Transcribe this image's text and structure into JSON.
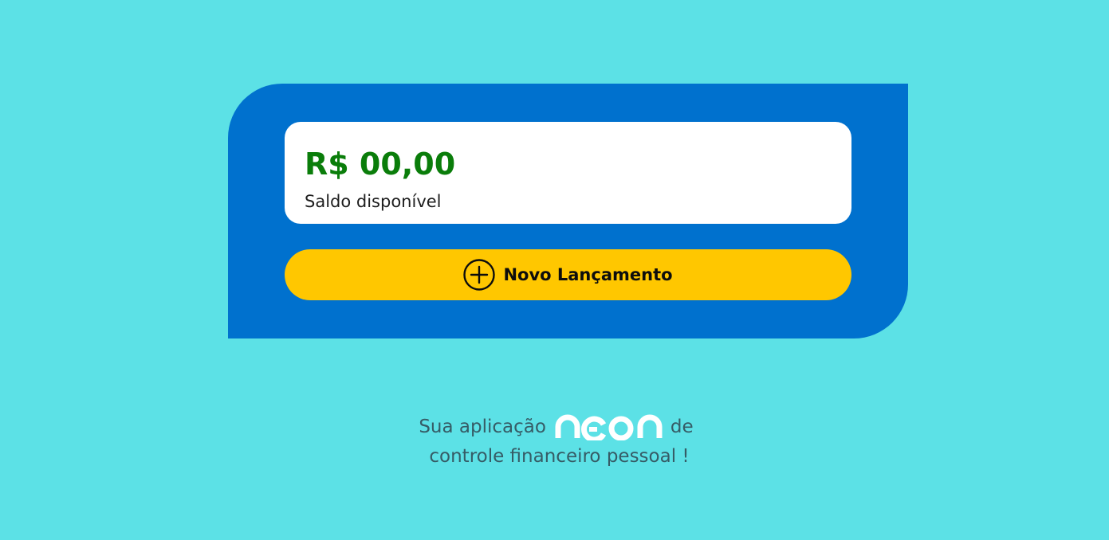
{
  "balance": {
    "amount": "R$ 00,00",
    "label": "Saldo disponível"
  },
  "actions": {
    "new_entry_label": "Novo Lançamento",
    "new_entry_icon": "plus-circle-icon"
  },
  "tagline": {
    "before_logo": "Sua aplicação",
    "logo_text": "neon",
    "after_logo": "de",
    "line2": "controle financeiro pessoal !"
  },
  "colors": {
    "background": "#5ce1e6",
    "panel": "#0071ce",
    "card": "#ffffff",
    "amount": "#0a7d0a",
    "button": "#ffc700",
    "tagline": "#365c66",
    "logo": "#ffffff"
  }
}
